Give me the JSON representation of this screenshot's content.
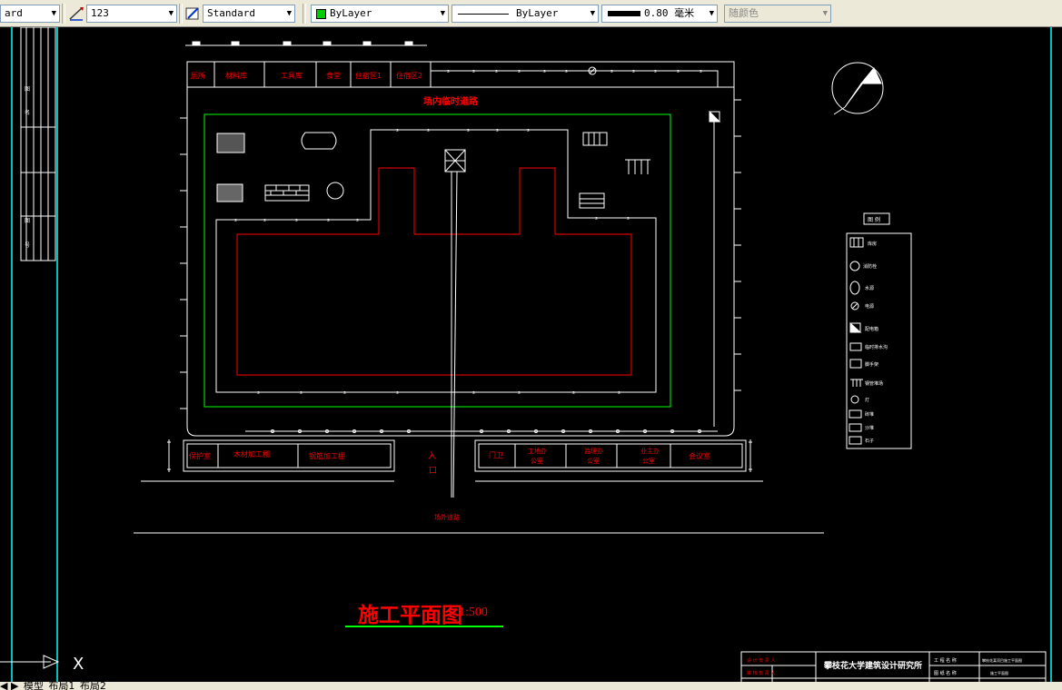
{
  "toolbar": {
    "text_style": "ard",
    "dim_style": "123",
    "table_style": "Standard",
    "layer_color_label": "ByLayer",
    "linetype_label": "ByLayer",
    "lineweight_label": "0.80 毫米",
    "plotstyle_label": "随颜色",
    "colors": {
      "layer_swatch": "#00cc00"
    }
  },
  "title_block_left": {
    "rows": [
      "图",
      "名",
      "",
      "图",
      "号"
    ]
  },
  "site": {
    "top_rooms": [
      "厕所",
      "材料库",
      "工具库",
      "食堂",
      "住宿区1",
      "住宿区2"
    ],
    "road_label": "场内临时道路",
    "bottom_left_rooms": [
      "保护室",
      "木材加工棚",
      "钢筋加工棚"
    ],
    "entrance": [
      "入",
      "口"
    ],
    "bottom_right_rooms": [
      "门卫",
      "工地办\n公室",
      "监理办\n公室",
      "业主办\n公室",
      "会议室"
    ],
    "outside_road": "场外道路"
  },
  "legend": {
    "title": "图 例",
    "items": [
      "库房",
      "消防栓",
      "水源",
      "电源",
      "配电箱",
      "临时排水沟",
      "脚手架",
      "钢管堆场",
      "灯",
      "砖堆",
      "沙堆",
      "石子"
    ]
  },
  "drawing_title": {
    "name": "施工平面图",
    "scale": "1:500"
  },
  "title_block": {
    "institute": "攀枝花大学建筑设计研究所",
    "cells": [
      "设 计 负 责 人",
      "审 核 负 责 人",
      "工 程 名 称",
      "图 纸 名 称",
      "攀枝花某项目施工平面图",
      "施工平面图"
    ]
  },
  "ucs_label": "X",
  "layout_tabs": [
    "模型",
    "布局1",
    "布局2"
  ],
  "colors": {
    "red": "#ff0000",
    "green": "#00ff00",
    "cyan": "#00ffff",
    "white": "#ffffff"
  }
}
